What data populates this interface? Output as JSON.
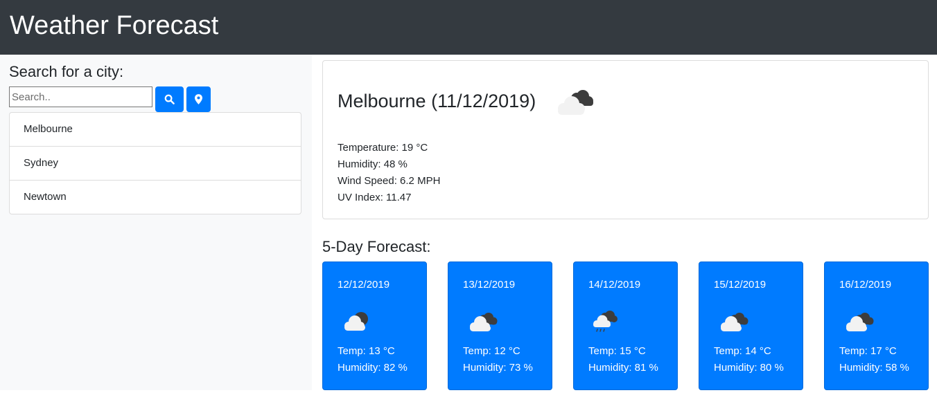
{
  "header": {
    "title": "Weather Forecast"
  },
  "sidebar": {
    "search_title": "Search for a city:",
    "search_placeholder": "Search..",
    "search_value": "",
    "search_button_icon": "search-icon",
    "locate_button_icon": "map-marker-icon",
    "cities": [
      {
        "label": "Melbourne"
      },
      {
        "label": "Sydney"
      },
      {
        "label": "Newtown"
      }
    ]
  },
  "current": {
    "title": "Melbourne (11/12/2019)",
    "icon": "cloudy-icon",
    "temperature": "Temperature: 19 °C",
    "humidity": "Humidity: 48 %",
    "wind": "Wind Speed: 6.2 MPH",
    "uv": "UV Index: 11.47"
  },
  "forecast": {
    "title": "5-Day Forecast:",
    "days": [
      {
        "date": "12/12/2019",
        "icon": "partly-cloudy-icon",
        "temp": "Temp: 13 °C",
        "humidity": "Humidity: 82 %"
      },
      {
        "date": "13/12/2019",
        "icon": "cloudy-icon",
        "temp": "Temp: 12 °C",
        "humidity": "Humidity: 73 %"
      },
      {
        "date": "14/12/2019",
        "icon": "rain-icon",
        "temp": "Temp: 15 °C",
        "humidity": "Humidity: 81 %"
      },
      {
        "date": "15/12/2019",
        "icon": "cloudy-icon",
        "temp": "Temp: 14 °C",
        "humidity": "Humidity: 80 %"
      },
      {
        "date": "16/12/2019",
        "icon": "cloudy-icon",
        "temp": "Temp: 17 °C",
        "humidity": "Humidity: 58 %"
      }
    ]
  },
  "colors": {
    "navbar": "#343a40",
    "sidebar_bg": "#f8f9fa",
    "primary": "#007bff"
  }
}
